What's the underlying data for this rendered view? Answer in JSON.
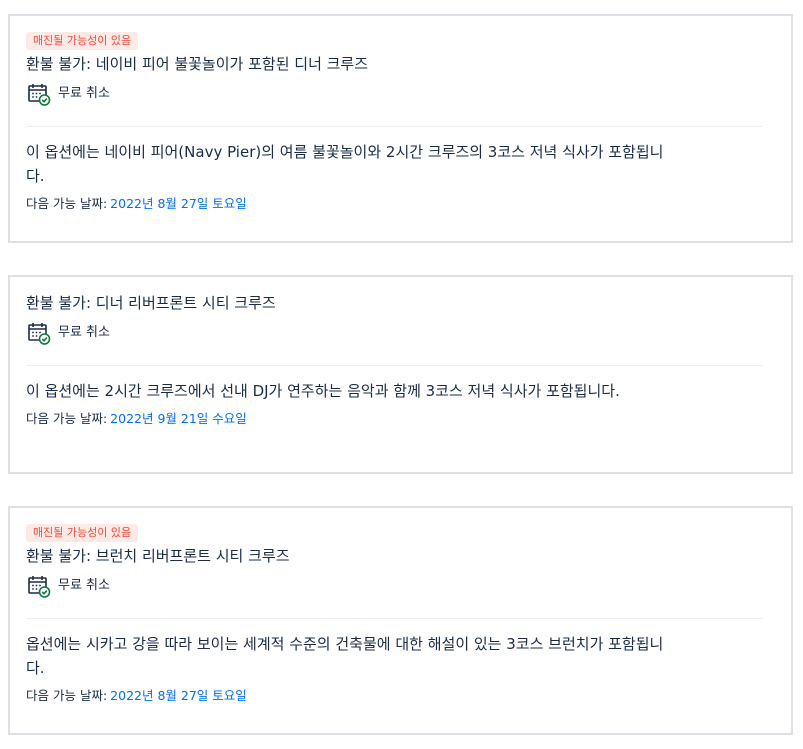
{
  "icons": {
    "calendar_check": "calendar-check-icon"
  },
  "colors": {
    "text": "#1a2b49",
    "badge_bg": "#fde9e5",
    "badge_text": "#eb4d3c",
    "date_link": "#0071eb",
    "check_green": "#0c7a3c",
    "card_border": "#dcdfe4"
  },
  "options": [
    {
      "badge": "매진될 가능성이 있음",
      "title": "환불 불가: 네이비 피어 불꽃놀이가 포함된 디너 크루즈",
      "cancellation": "무료 취소",
      "description": "이 옵션에는 네이비 피어(Navy Pier)의 여름 불꽃놀이와 2시간 크루즈의 3코스 저녁 식사가 포함됩니다.",
      "availability_label": "다음 가능 날짜:",
      "availability_date": "2022년 8월 27일 토요일"
    },
    {
      "badge": "",
      "title": "환불 불가: 디너 리버프론트 시티 크루즈",
      "cancellation": "무료 취소",
      "description": "이 옵션에는 2시간 크루즈에서 선내 DJ가 연주하는 음악과 함께 3코스 저녁 식사가 포함됩니다.",
      "availability_label": "다음 가능 날짜:",
      "availability_date": "2022년 9월 21일 수요일"
    },
    {
      "badge": "매진될 가능성이 있음",
      "title": "환불 불가: 브런치 리버프론트 시티 크루즈",
      "cancellation": "무료 취소",
      "description": "옵션에는 시카고 강을 따라 보이는 세계적 수준의 건축물에 대한 해설이 있는 3코스 브런치가 포함됩니다.",
      "availability_label": "다음 가능 날짜:",
      "availability_date": "2022년 8월 27일 토요일"
    }
  ]
}
